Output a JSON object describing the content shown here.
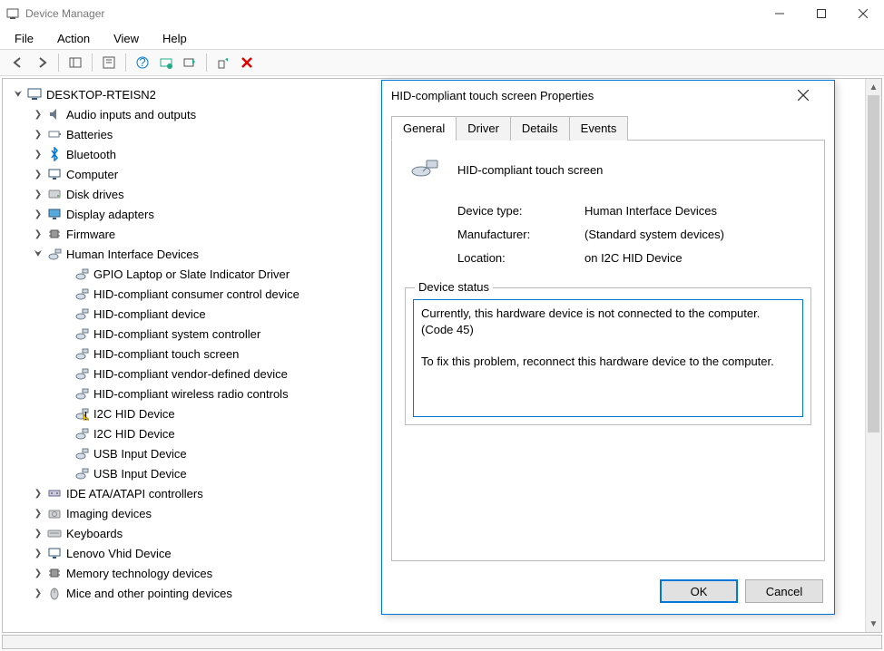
{
  "window": {
    "title": "Device Manager",
    "controls": {
      "min": "—",
      "max": "▢",
      "close": "✕"
    }
  },
  "menu": [
    "File",
    "Action",
    "View",
    "Help"
  ],
  "tree": {
    "root": "DESKTOP-RTEISN2",
    "categories": [
      {
        "label": "Audio inputs and outputs",
        "icon": "speaker"
      },
      {
        "label": "Batteries",
        "icon": "battery"
      },
      {
        "label": "Bluetooth",
        "icon": "bluetooth"
      },
      {
        "label": "Computer",
        "icon": "monitor"
      },
      {
        "label": "Disk drives",
        "icon": "disk"
      },
      {
        "label": "Display adapters",
        "icon": "display"
      },
      {
        "label": "Firmware",
        "icon": "chip"
      },
      {
        "label": "Human Interface Devices",
        "icon": "hid",
        "expanded": true,
        "children": [
          {
            "label": "GPIO Laptop or Slate Indicator Driver",
            "icon": "hid-dev"
          },
          {
            "label": "HID-compliant consumer control device",
            "icon": "hid-dev"
          },
          {
            "label": "HID-compliant device",
            "icon": "hid-dev"
          },
          {
            "label": "HID-compliant system controller",
            "icon": "hid-dev"
          },
          {
            "label": "HID-compliant touch screen",
            "icon": "hid-dev"
          },
          {
            "label": "HID-compliant vendor-defined device",
            "icon": "hid-dev"
          },
          {
            "label": "HID-compliant wireless radio controls",
            "icon": "hid-dev"
          },
          {
            "label": "I2C HID Device",
            "icon": "hid-dev-warn"
          },
          {
            "label": "I2C HID Device",
            "icon": "hid-dev"
          },
          {
            "label": "USB Input Device",
            "icon": "hid-dev"
          },
          {
            "label": "USB Input Device",
            "icon": "hid-dev"
          }
        ]
      },
      {
        "label": "IDE ATA/ATAPI controllers",
        "icon": "ide"
      },
      {
        "label": "Imaging devices",
        "icon": "camera"
      },
      {
        "label": "Keyboards",
        "icon": "keyboard"
      },
      {
        "label": "Lenovo Vhid Device",
        "icon": "monitor"
      },
      {
        "label": "Memory technology devices",
        "icon": "chip"
      },
      {
        "label": "Mice and other pointing devices",
        "icon": "mouse"
      }
    ]
  },
  "dialog": {
    "title": "HID-compliant touch screen Properties",
    "tabs": [
      "General",
      "Driver",
      "Details",
      "Events"
    ],
    "device_name": "HID-compliant touch screen",
    "rows": {
      "type_label": "Device type:",
      "type_value": "Human Interface Devices",
      "mfr_label": "Manufacturer:",
      "mfr_value": "(Standard system devices)",
      "loc_label": "Location:",
      "loc_value": "on I2C HID Device"
    },
    "status_legend": "Device status",
    "status_line1": "Currently, this hardware device is not connected to the computer. (Code 45)",
    "status_line2": "To fix this problem, reconnect this hardware device to the computer.",
    "buttons": {
      "ok": "OK",
      "cancel": "Cancel"
    }
  }
}
